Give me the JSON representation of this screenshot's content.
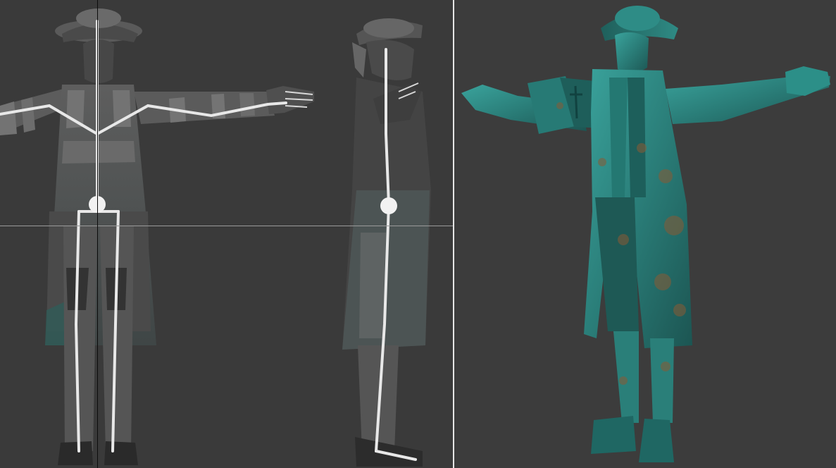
{
  "viewports": [
    {
      "id": "rig",
      "content": "rigged-character-front-and-side"
    },
    {
      "id": "render",
      "content": "textured-bronze-statue-character"
    }
  ],
  "colors": {
    "viewport_bg": "#3a3a3a",
    "divider": "#e6e6e6",
    "bone": "#e8e8e8",
    "mesh": "#5a5a5a",
    "patina": "#2f8a84",
    "rust": "#8a5a34"
  }
}
